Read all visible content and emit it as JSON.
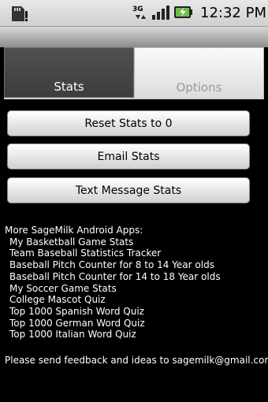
{
  "status_bar": {
    "network_label": "3G",
    "time": "12:32 PM"
  },
  "tabs": [
    {
      "label": "Stats",
      "active": true
    },
    {
      "label": "Options",
      "active": false
    }
  ],
  "buttons": {
    "reset": "Reset Stats to 0",
    "email": "Email Stats",
    "text": "Text Message Stats"
  },
  "more_apps": {
    "heading": "More SageMilk Android Apps:",
    "items": [
      "My Basketball Game Stats",
      "Team Baseball Statistics Tracker",
      "Baseball Pitch Counter for 8 to 14 Year olds",
      "Baseball Pitch Counter for 14 to 18 Year olds",
      "My Soccer Game Stats",
      "College Mascot Quiz",
      "Top 1000 Spanish Word Quiz",
      "Top 1000 German Word Quiz",
      "Top 1000 Italian Word Quiz"
    ]
  },
  "feedback": "Please send feedback and ideas to sagemilk@gmail.com."
}
